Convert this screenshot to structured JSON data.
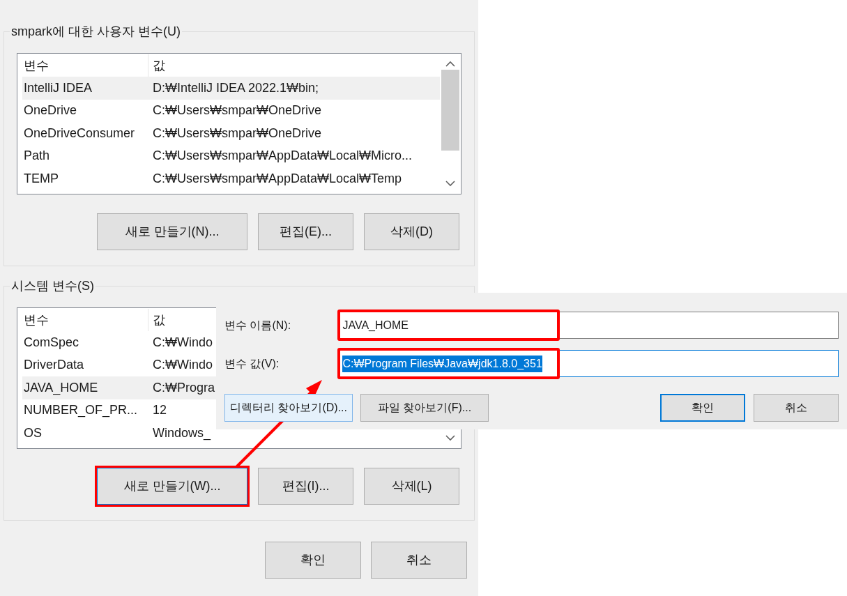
{
  "user_group": {
    "title": "smpark에 대한 사용자 변수(U)",
    "columns": [
      "변수",
      "값"
    ],
    "rows": [
      {
        "name": "IntelliJ IDEA",
        "value": "D:₩IntelliJ IDEA 2022.1₩bin;",
        "selected": true
      },
      {
        "name": "OneDrive",
        "value": "C:₩Users₩smpar₩OneDrive",
        "selected": false
      },
      {
        "name": "OneDriveConsumer",
        "value": "C:₩Users₩smpar₩OneDrive",
        "selected": false
      },
      {
        "name": "Path",
        "value": "C:₩Users₩smpar₩AppData₩Local₩Micro...",
        "selected": false
      },
      {
        "name": "TEMP",
        "value": "C:₩Users₩smpar₩AppData₩Local₩Temp",
        "selected": false
      }
    ],
    "buttons": [
      {
        "label": "새로 만들기(N)...",
        "highlighted": false
      },
      {
        "label": "편집(E)...",
        "highlighted": false
      },
      {
        "label": "삭제(D)",
        "highlighted": false
      }
    ]
  },
  "system_group": {
    "title": "시스템 변수(S)",
    "columns": [
      "변수",
      "값"
    ],
    "rows": [
      {
        "name": "ComSpec",
        "value": "C:₩Windo",
        "selected": false
      },
      {
        "name": "DriverData",
        "value": "C:₩Windo",
        "selected": false
      },
      {
        "name": "JAVA_HOME",
        "value": "C:₩Progra",
        "selected": true
      },
      {
        "name": "NUMBER_OF_PR...",
        "value": "12",
        "selected": false
      },
      {
        "name": "OS",
        "value": "Windows_",
        "selected": false
      }
    ],
    "buttons": [
      {
        "label": "새로 만들기(W)...",
        "highlighted": true
      },
      {
        "label": "편집(I)...",
        "highlighted": false
      },
      {
        "label": "삭제(L)",
        "highlighted": false
      }
    ]
  },
  "footer_buttons": [
    "확인",
    "취소"
  ],
  "edit_dialog": {
    "name_field": {
      "label": "변수 이름(N):",
      "value": "JAVA_HOME",
      "highlighted": true
    },
    "value_field": {
      "label": "변수 값(V):",
      "value": "C:₩Program Files₩Java₩jdk1.8.0_351",
      "highlighted": true,
      "selected": true
    },
    "browse_buttons": [
      "디렉터리 찾아보기(D)...",
      "파일 찾아보기(F)..."
    ],
    "buttons": [
      {
        "label": "확인",
        "default": true
      },
      {
        "label": "취소",
        "default": false
      }
    ]
  }
}
